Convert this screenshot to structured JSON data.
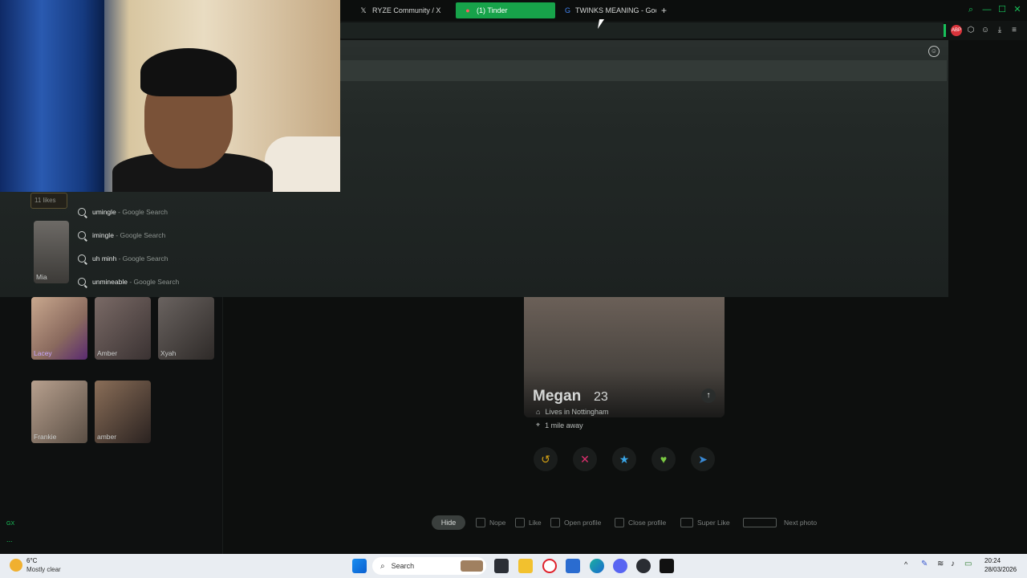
{
  "browser": {
    "tabs": [
      {
        "label": "RYZE Community / X",
        "icon": "x-icon"
      },
      {
        "label": "(1) Tinder",
        "icon": "tinder-icon",
        "active": true
      },
      {
        "label": "TWINKS MEANING - Goog",
        "icon": "google-icon"
      }
    ],
    "new_tab": "+",
    "accent": "#17a34a"
  },
  "suggestions": [
    {
      "query": "umingle",
      "source": " - Google Search"
    },
    {
      "query": "imingle",
      "source": " - Google Search"
    },
    {
      "query": "uh minh",
      "source": " - Google Search"
    },
    {
      "query": "unmineable",
      "source": " - Google Search"
    }
  ],
  "likes": {
    "count_label": "11 likes"
  },
  "matches": [
    {
      "name": "Mia"
    },
    {
      "name": "Lacey"
    },
    {
      "name": "Amber"
    },
    {
      "name": "Xyah"
    },
    {
      "name": "Frankie"
    },
    {
      "name": "amber"
    }
  ],
  "profile": {
    "name": "Megan",
    "age": "23",
    "lives": "Lives in Nottingham",
    "distance": "1 mile away"
  },
  "hints": {
    "hide": "Hide",
    "nope": "Nope",
    "like": "Like",
    "open_profile": "Open profile",
    "close_profile": "Close profile",
    "super_like": "Super Like",
    "next_photo": "Next photo"
  },
  "sidebar": {
    "gx": "GX",
    "more": "..."
  },
  "taskbar": {
    "weather_temp": "6°C",
    "weather_desc": "Mostly clear",
    "search_placeholder": "Search",
    "time": "20:24",
    "date": "28/03/2026"
  }
}
